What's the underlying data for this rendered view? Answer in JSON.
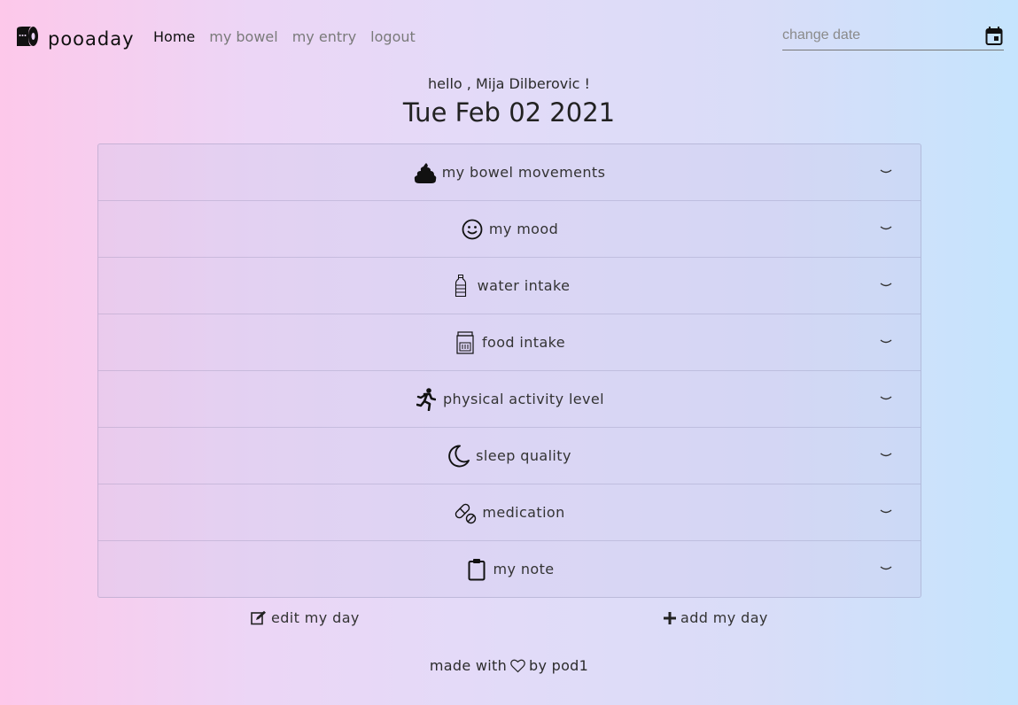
{
  "brand": {
    "name": "pooaday",
    "logo_icon": "toilet-paper-icon"
  },
  "nav": {
    "links": [
      {
        "label": "Home",
        "active": true
      },
      {
        "label": "my bowel"
      },
      {
        "label": "my entry"
      },
      {
        "label": "logout"
      }
    ]
  },
  "date_picker": {
    "placeholder": "change date",
    "icon": "calendar-icon"
  },
  "greeting": {
    "text": "hello , Mija Dilberovic !"
  },
  "current_date": "Tue Feb 02 2021",
  "sections": [
    {
      "label": "my bowel movements",
      "icon": "poop-icon"
    },
    {
      "label": "my mood",
      "icon": "smile-icon"
    },
    {
      "label": "water intake",
      "icon": "water-bottle-icon"
    },
    {
      "label": "food intake",
      "icon": "food-jar-icon"
    },
    {
      "label": "physical activity level",
      "icon": "running-icon"
    },
    {
      "label": "sleep quality",
      "icon": "moon-icon"
    },
    {
      "label": "medication",
      "icon": "pills-icon"
    },
    {
      "label": "my note",
      "icon": "clipboard-icon"
    }
  ],
  "actions": {
    "edit_label": "edit my day",
    "add_label": "add my day"
  },
  "footer": {
    "prefix": "made with",
    "suffix": "by pod1",
    "icon": "heart-icon"
  }
}
